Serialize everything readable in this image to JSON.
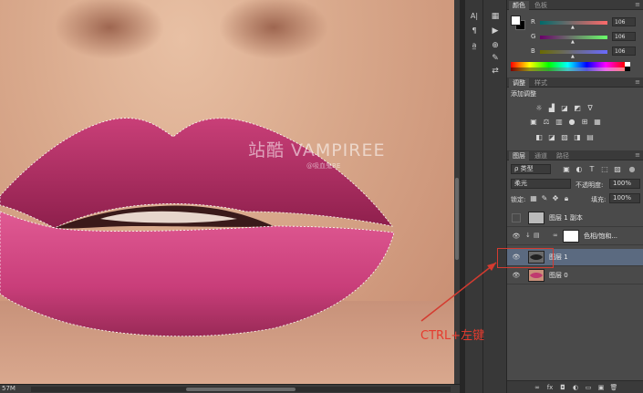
{
  "canvas": {
    "watermark": "站酷 VAMPIREE",
    "watermark_sub": "@吸血鬼RE"
  },
  "status": {
    "zoom": "57M"
  },
  "tools": [
    "text-tool-icon",
    "paragraph-icon",
    "character-style-icon"
  ],
  "strip": [
    "history-icon",
    "play-icon",
    "clone-source-icon",
    "brush-preset-icon",
    "layer-comp-icon"
  ],
  "color_panel": {
    "tabs": [
      "颜色",
      "色板"
    ],
    "sliders": [
      {
        "label": "R",
        "value": "106"
      },
      {
        "label": "G",
        "value": "106"
      },
      {
        "label": "B",
        "value": "106"
      }
    ]
  },
  "adjust_panel": {
    "tabs": [
      "调整",
      "样式"
    ],
    "title": "添加调整",
    "icons": [
      "☼",
      "▟",
      "◪",
      "◩",
      "∇",
      "▣",
      "⚖",
      "▥",
      "●",
      "⊞",
      "▦",
      "◧",
      "◪",
      "▨",
      "◨",
      "▤"
    ]
  },
  "layers_panel": {
    "tabs": [
      "图层",
      "通道",
      "路径"
    ],
    "filter_label": "ρ 类型",
    "blend_mode": "柔光",
    "opacity_label": "不透明度:",
    "opacity_value": "100%",
    "lock_label": "锁定:",
    "fill_label": "填充:",
    "fill_value": "100%",
    "layers": [
      {
        "name": "图层 1 副本",
        "visible": false,
        "selected": false
      },
      {
        "name": "色相/饱和...",
        "visible": true,
        "selected": false
      },
      {
        "name": "图层 1",
        "visible": true,
        "selected": true
      },
      {
        "name": "图层 0",
        "visible": true,
        "selected": false
      }
    ]
  },
  "annotation": {
    "text": "CTRL+左键",
    "color": "#e63b2e"
  }
}
